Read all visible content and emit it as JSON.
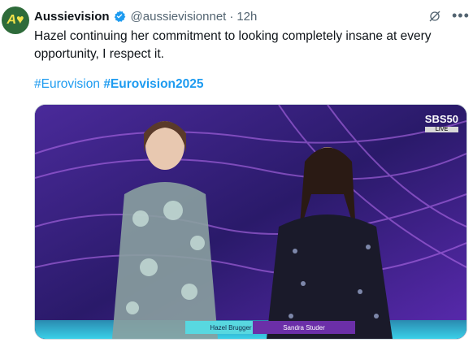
{
  "tweet": {
    "author_name": "Aussievision",
    "handle": "@aussievisionnet",
    "separator": "·",
    "time": "12h",
    "text": "Hazel continuing her commitment to looking completely insane at every opportunity, I respect it.",
    "hashtags": [
      "#Eurovision",
      "#Eurovision2025"
    ]
  },
  "icons": {
    "avatar": "aussievision-logo-icon",
    "verified": "verified-badge-icon",
    "grok": "grok-icon",
    "more": "more-options-icon"
  },
  "media": {
    "broadcaster_logo": "SBS50",
    "broadcaster_sub": "LIVE",
    "lower_third_left": "Hazel Brugger",
    "lower_third_right": "Sandra Studer"
  },
  "colors": {
    "link": "#1d9bf0",
    "verified": "#1d9bf0",
    "lower_third_left": "#58d8e0",
    "lower_third_right": "#6b2fa8"
  }
}
